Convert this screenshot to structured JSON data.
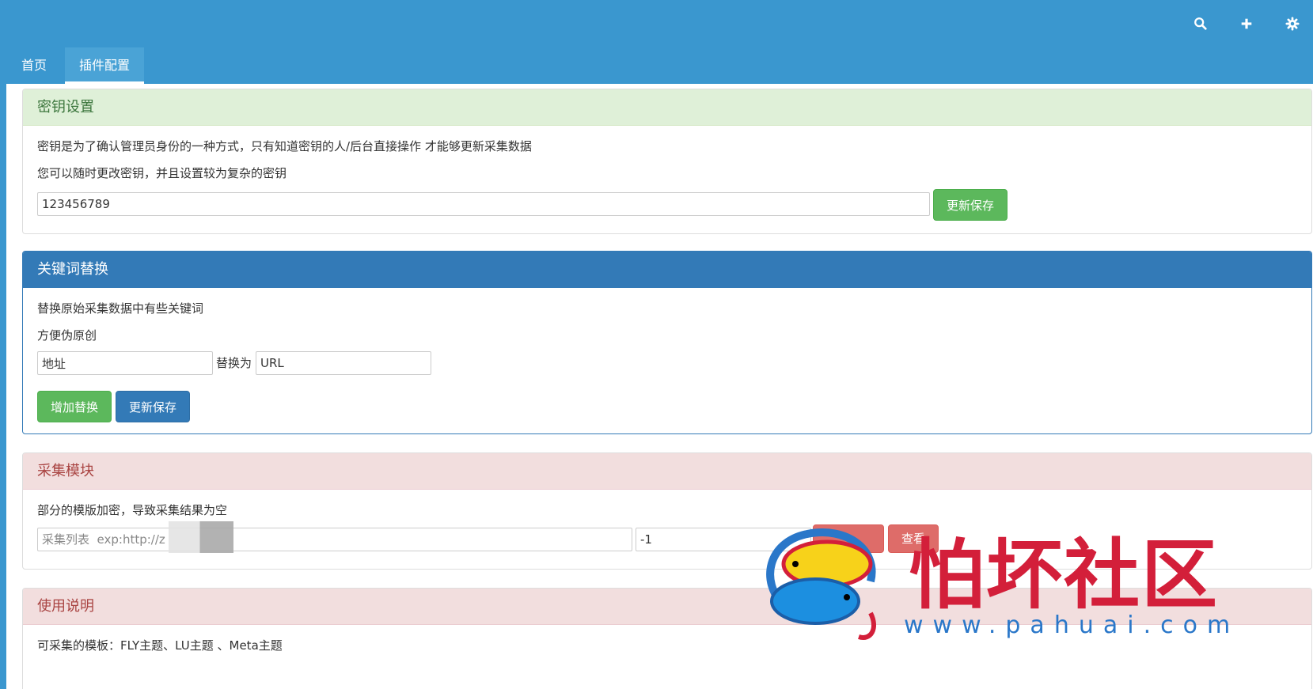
{
  "topbar": {
    "icons": [
      "search-icon",
      "plus-icon",
      "gear-icon"
    ]
  },
  "tabs": [
    {
      "label": "首页"
    },
    {
      "label": "插件配置"
    }
  ],
  "key_panel": {
    "title": "密钥设置",
    "line1": "密钥是为了确认管理员身份的一种方式，只有知道密钥的人/后台直接操作 才能够更新采集数据",
    "line2": "您可以随时更改密钥，并且设置较为复杂的密钥",
    "key_value": "123456789",
    "save_label": "更新保存"
  },
  "keyword_panel": {
    "title": "关键词替换",
    "line1": "替换原始采集数据中有些关键词",
    "line2": "方便伪原创",
    "from_value": "地址",
    "replace_label": "替换为",
    "to_value": "URL",
    "add_label": "增加替换",
    "save_label": "更新保存"
  },
  "collect_panel": {
    "title": "采集模块",
    "line1": "部分的模版加密，导致采集结果为空",
    "list_placeholder": "采集列表  exp:http://z",
    "page_value": "-1",
    "view_label": "查看"
  },
  "usage_panel": {
    "title": "使用说明",
    "line1": "可采集的模板：FLY主题、LU主题 、Meta主题"
  },
  "watermark": {
    "brand": "怕坏社区",
    "url": "www.pahuai.com"
  },
  "colors": {
    "topbar": "#3a97cf",
    "success": "#5cb85c",
    "primary": "#337ab7",
    "danger": "#d9534f"
  }
}
